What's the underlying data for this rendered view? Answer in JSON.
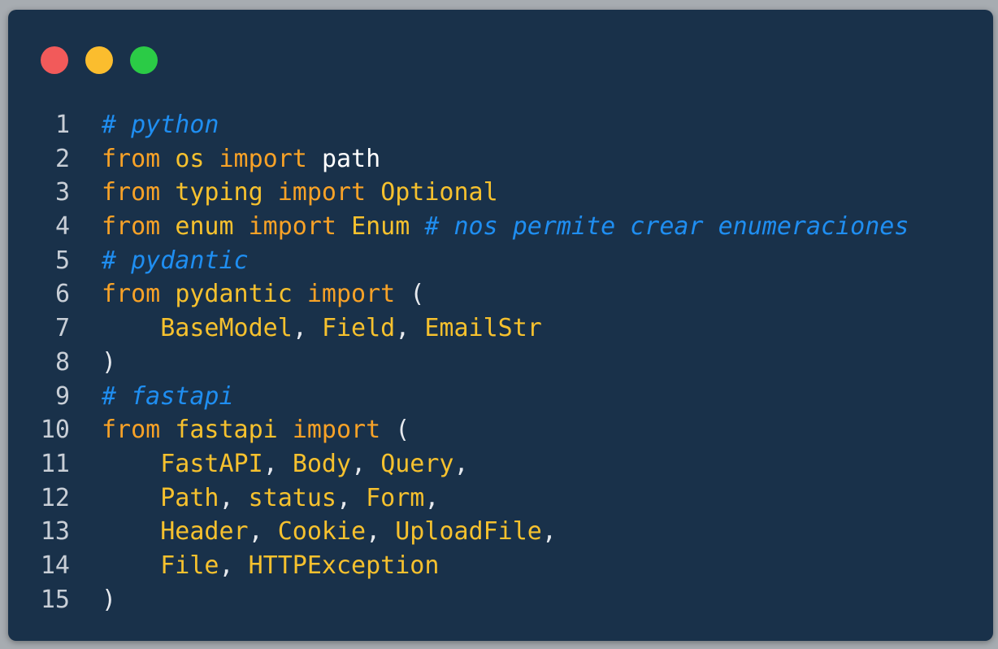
{
  "window": {
    "traffic_lights": [
      "close",
      "minimize",
      "maximize"
    ],
    "colors": {
      "background": "#19314a",
      "close": "#f25a5a",
      "minimize": "#fbbd2e",
      "maximize": "#2bcb46",
      "keyword": "#f8a227",
      "identifier": "#f6c12e",
      "comment": "#1f8ef1",
      "line_number": "#c8ced6"
    }
  },
  "code": {
    "lines": [
      {
        "n": "1",
        "tokens": [
          {
            "t": "# python",
            "c": "cm"
          }
        ]
      },
      {
        "n": "2",
        "tokens": [
          {
            "t": "from",
            "c": "kw"
          },
          {
            "t": " "
          },
          {
            "t": "os",
            "c": "mod"
          },
          {
            "t": " "
          },
          {
            "t": "import",
            "c": "kw"
          },
          {
            "t": " "
          },
          {
            "t": "path",
            "c": "plain"
          }
        ]
      },
      {
        "n": "3",
        "tokens": [
          {
            "t": "from",
            "c": "kw"
          },
          {
            "t": " "
          },
          {
            "t": "typing",
            "c": "mod"
          },
          {
            "t": " "
          },
          {
            "t": "import",
            "c": "kw"
          },
          {
            "t": " "
          },
          {
            "t": "Optional",
            "c": "name"
          }
        ]
      },
      {
        "n": "4",
        "tokens": [
          {
            "t": "from",
            "c": "kw"
          },
          {
            "t": " "
          },
          {
            "t": "enum",
            "c": "mod"
          },
          {
            "t": " "
          },
          {
            "t": "import",
            "c": "kw"
          },
          {
            "t": " "
          },
          {
            "t": "Enum",
            "c": "name"
          },
          {
            "t": " "
          },
          {
            "t": "# nos permite crear enumeraciones",
            "c": "cm"
          }
        ]
      },
      {
        "n": "5",
        "tokens": [
          {
            "t": "# pydantic",
            "c": "cm"
          }
        ]
      },
      {
        "n": "6",
        "tokens": [
          {
            "t": "from",
            "c": "kw"
          },
          {
            "t": " "
          },
          {
            "t": "pydantic",
            "c": "mod"
          },
          {
            "t": " "
          },
          {
            "t": "import",
            "c": "kw"
          },
          {
            "t": " "
          },
          {
            "t": "(",
            "c": "punc"
          }
        ]
      },
      {
        "n": "7",
        "tokens": [
          {
            "t": "    "
          },
          {
            "t": "BaseModel",
            "c": "name"
          },
          {
            "t": ", ",
            "c": "punc"
          },
          {
            "t": "Field",
            "c": "name"
          },
          {
            "t": ", ",
            "c": "punc"
          },
          {
            "t": "EmailStr",
            "c": "name"
          }
        ]
      },
      {
        "n": "8",
        "tokens": [
          {
            "t": ")",
            "c": "punc"
          }
        ]
      },
      {
        "n": "9",
        "tokens": [
          {
            "t": "# fastapi",
            "c": "cm"
          }
        ]
      },
      {
        "n": "10",
        "tokens": [
          {
            "t": "from",
            "c": "kw"
          },
          {
            "t": " "
          },
          {
            "t": "fastapi",
            "c": "mod"
          },
          {
            "t": " "
          },
          {
            "t": "import",
            "c": "kw"
          },
          {
            "t": " "
          },
          {
            "t": "(",
            "c": "punc"
          }
        ]
      },
      {
        "n": "11",
        "tokens": [
          {
            "t": "    "
          },
          {
            "t": "FastAPI",
            "c": "name"
          },
          {
            "t": ", ",
            "c": "punc"
          },
          {
            "t": "Body",
            "c": "name"
          },
          {
            "t": ", ",
            "c": "punc"
          },
          {
            "t": "Query",
            "c": "name"
          },
          {
            "t": ",",
            "c": "punc"
          }
        ]
      },
      {
        "n": "12",
        "tokens": [
          {
            "t": "    "
          },
          {
            "t": "Path",
            "c": "name"
          },
          {
            "t": ", ",
            "c": "punc"
          },
          {
            "t": "status",
            "c": "name"
          },
          {
            "t": ", ",
            "c": "punc"
          },
          {
            "t": "Form",
            "c": "name"
          },
          {
            "t": ",",
            "c": "punc"
          }
        ]
      },
      {
        "n": "13",
        "tokens": [
          {
            "t": "    "
          },
          {
            "t": "Header",
            "c": "name"
          },
          {
            "t": ", ",
            "c": "punc"
          },
          {
            "t": "Cookie",
            "c": "name"
          },
          {
            "t": ", ",
            "c": "punc"
          },
          {
            "t": "UploadFile",
            "c": "name"
          },
          {
            "t": ",",
            "c": "punc"
          }
        ]
      },
      {
        "n": "14",
        "tokens": [
          {
            "t": "    "
          },
          {
            "t": "File",
            "c": "name"
          },
          {
            "t": ", ",
            "c": "punc"
          },
          {
            "t": "HTTPException",
            "c": "name"
          }
        ]
      },
      {
        "n": "15",
        "tokens": [
          {
            "t": ")",
            "c": "punc"
          }
        ]
      }
    ]
  }
}
